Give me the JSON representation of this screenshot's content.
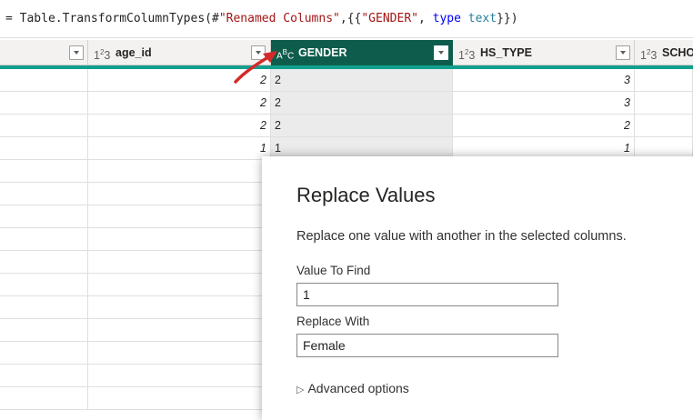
{
  "formula": {
    "prefix": "= Table.TransformColumnTypes(#",
    "step": "\"Renamed Columns\"",
    "mid": ",{{",
    "col": "\"GENDER\"",
    "comma": ", ",
    "kw": "type",
    "sp": " ",
    "type": "text",
    "suffix": "}})"
  },
  "columns": {
    "age_id": {
      "label": "age_id",
      "type_icon": "1²3"
    },
    "gender": {
      "label": "GENDER",
      "type_icon": "ABC"
    },
    "hs_type": {
      "label": "HS_TYPE",
      "type_icon": "1²3"
    },
    "scho": {
      "label": "SCHO",
      "type_icon": "1²3"
    }
  },
  "rows": [
    {
      "age_id": "2",
      "gender": "2",
      "hs_type": "3"
    },
    {
      "age_id": "2",
      "gender": "2",
      "hs_type": "3"
    },
    {
      "age_id": "2",
      "gender": "2",
      "hs_type": "2"
    },
    {
      "age_id": "1",
      "gender": "1",
      "hs_type": "1"
    },
    {
      "age_id": "",
      "gender": "",
      "hs_type": ""
    },
    {
      "age_id": "",
      "gender": "",
      "hs_type": ""
    },
    {
      "age_id": "",
      "gender": "",
      "hs_type": ""
    },
    {
      "age_id": "",
      "gender": "",
      "hs_type": ""
    },
    {
      "age_id": "",
      "gender": "",
      "hs_type": ""
    },
    {
      "age_id": "",
      "gender": "",
      "hs_type": ""
    },
    {
      "age_id": "",
      "gender": "",
      "hs_type": ""
    },
    {
      "age_id": "",
      "gender": "",
      "hs_type": ""
    },
    {
      "age_id": "",
      "gender": "",
      "hs_type": ""
    },
    {
      "age_id": "",
      "gender": "",
      "hs_type": ""
    },
    {
      "age_id": "",
      "gender": "",
      "hs_type": ""
    }
  ],
  "dialog": {
    "title": "Replace Values",
    "description": "Replace one value with another in the selected columns.",
    "find_label": "Value To Find",
    "find_value": "1",
    "replace_label": "Replace With",
    "replace_value": "Female",
    "advanced_label": "Advanced options"
  },
  "colors": {
    "selected_header": "#0e5d4c",
    "teal_line": "#12a08e",
    "annotation_arrow": "#d42a2a"
  }
}
